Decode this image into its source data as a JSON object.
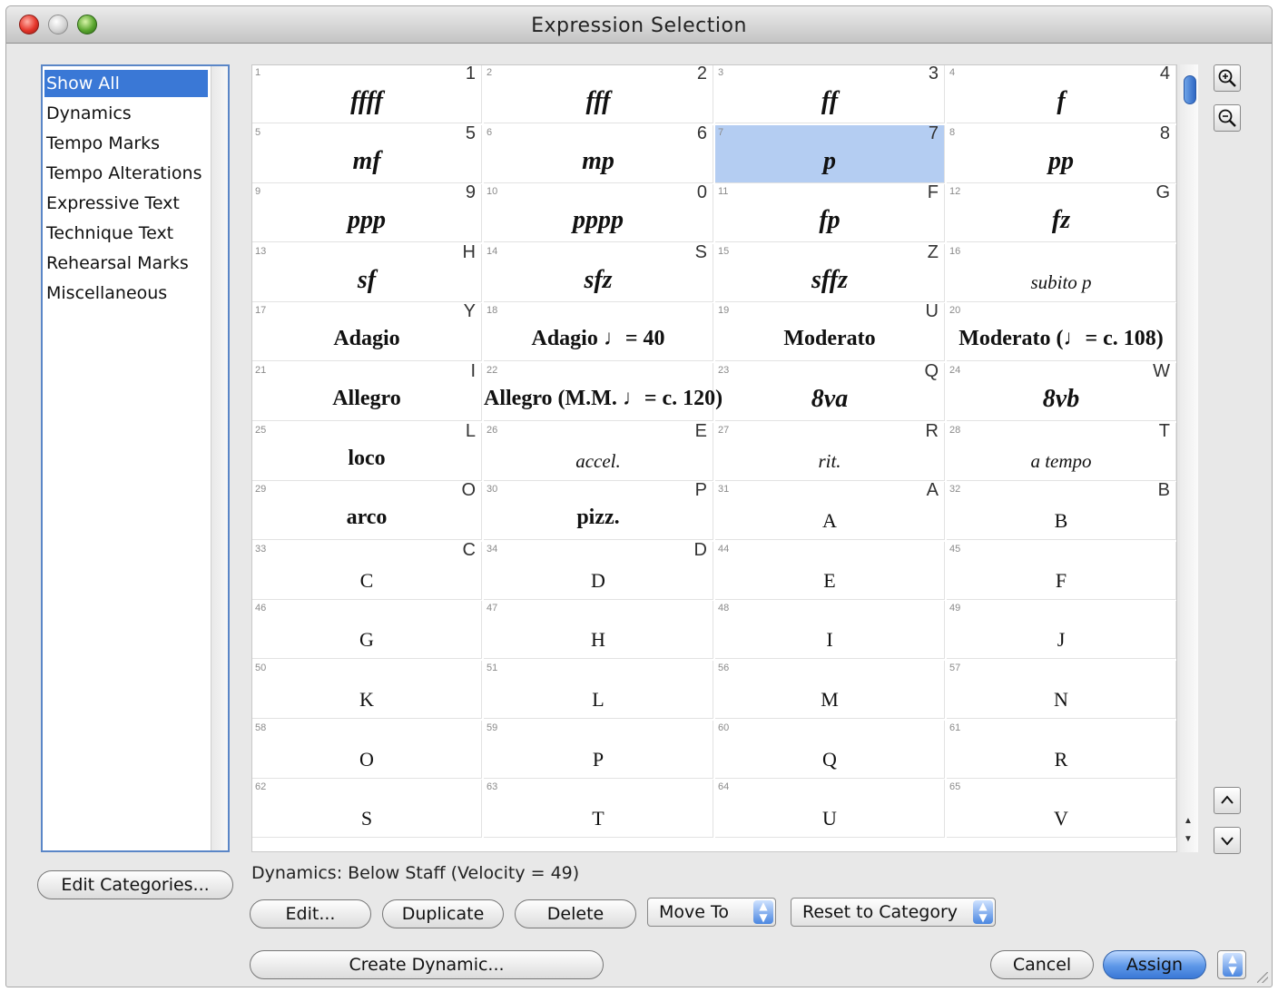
{
  "window": {
    "title": "Expression Selection"
  },
  "categories": [
    "Show All",
    "Dynamics",
    "Tempo Marks",
    "Tempo Alterations",
    "Expressive Text",
    "Technique Text",
    "Rehearsal Marks",
    "Miscellaneous"
  ],
  "selected_category": 0,
  "expressions": [
    {
      "num": "1",
      "key": "1",
      "label": "ffff",
      "style": "bi"
    },
    {
      "num": "2",
      "key": "2",
      "label": "fff",
      "style": "bi"
    },
    {
      "num": "3",
      "key": "3",
      "label": "ff",
      "style": "bi"
    },
    {
      "num": "4",
      "key": "4",
      "label": "f",
      "style": "bi"
    },
    {
      "num": "5",
      "key": "5",
      "label": "mf",
      "style": "bi"
    },
    {
      "num": "6",
      "key": "6",
      "label": "mp",
      "style": "bi"
    },
    {
      "num": "7",
      "key": "7",
      "label": "p",
      "style": "bi",
      "selected": true
    },
    {
      "num": "8",
      "key": "8",
      "label": "pp",
      "style": "bi"
    },
    {
      "num": "9",
      "key": "9",
      "label": "ppp",
      "style": "bi"
    },
    {
      "num": "10",
      "key": "0",
      "label": "pppp",
      "style": "bi"
    },
    {
      "num": "11",
      "key": "F",
      "label": "fp",
      "style": "bi"
    },
    {
      "num": "12",
      "key": "G",
      "label": "fz",
      "style": "bi"
    },
    {
      "num": "13",
      "key": "H",
      "label": "sf",
      "style": "bi"
    },
    {
      "num": "14",
      "key": "S",
      "label": "sfz",
      "style": "bi"
    },
    {
      "num": "15",
      "key": "Z",
      "label": "sffz",
      "style": "bi"
    },
    {
      "num": "16",
      "key": "",
      "label": "subito p",
      "style": "i"
    },
    {
      "num": "17",
      "key": "Y",
      "label": "Adagio",
      "style": "b"
    },
    {
      "num": "18",
      "key": "",
      "label": "Adagio ♩= 40",
      "style": "b"
    },
    {
      "num": "19",
      "key": "U",
      "label": "Moderato",
      "style": "b"
    },
    {
      "num": "20",
      "key": "",
      "label": "Moderato (♩= c. 108)",
      "style": "b"
    },
    {
      "num": "21",
      "key": "I",
      "label": "Allegro",
      "style": "b"
    },
    {
      "num": "22",
      "key": "",
      "label": "Allegro (M.M. ♩= c. 120)",
      "style": "b"
    },
    {
      "num": "23",
      "key": "Q",
      "label": "8va",
      "style": "bi"
    },
    {
      "num": "24",
      "key": "W",
      "label": "8vb",
      "style": "bi"
    },
    {
      "num": "25",
      "key": "L",
      "label": "loco",
      "style": "b"
    },
    {
      "num": "26",
      "key": "E",
      "label": "accel.",
      "style": "i"
    },
    {
      "num": "27",
      "key": "R",
      "label": "rit.",
      "style": "i"
    },
    {
      "num": "28",
      "key": "T",
      "label": "a tempo",
      "style": "i"
    },
    {
      "num": "29",
      "key": "O",
      "label": "arco",
      "style": "b"
    },
    {
      "num": "30",
      "key": "P",
      "label": "pizz.",
      "style": "b"
    },
    {
      "num": "31",
      "key": "A",
      "label": "A",
      "style": ""
    },
    {
      "num": "32",
      "key": "B",
      "label": "B",
      "style": ""
    },
    {
      "num": "33",
      "key": "C",
      "label": "C",
      "style": ""
    },
    {
      "num": "34",
      "key": "D",
      "label": "D",
      "style": ""
    },
    {
      "num": "44",
      "key": "",
      "label": "E",
      "style": ""
    },
    {
      "num": "45",
      "key": "",
      "label": "F",
      "style": ""
    },
    {
      "num": "46",
      "key": "",
      "label": "G",
      "style": ""
    },
    {
      "num": "47",
      "key": "",
      "label": "H",
      "style": ""
    },
    {
      "num": "48",
      "key": "",
      "label": "I",
      "style": ""
    },
    {
      "num": "49",
      "key": "",
      "label": "J",
      "style": ""
    },
    {
      "num": "50",
      "key": "",
      "label": "K",
      "style": ""
    },
    {
      "num": "51",
      "key": "",
      "label": "L",
      "style": ""
    },
    {
      "num": "56",
      "key": "",
      "label": "M",
      "style": ""
    },
    {
      "num": "57",
      "key": "",
      "label": "N",
      "style": ""
    },
    {
      "num": "58",
      "key": "",
      "label": "O",
      "style": ""
    },
    {
      "num": "59",
      "key": "",
      "label": "P",
      "style": ""
    },
    {
      "num": "60",
      "key": "",
      "label": "Q",
      "style": ""
    },
    {
      "num": "61",
      "key": "",
      "label": "R",
      "style": ""
    },
    {
      "num": "62",
      "key": "",
      "label": "S",
      "style": ""
    },
    {
      "num": "63",
      "key": "",
      "label": "T",
      "style": ""
    },
    {
      "num": "64",
      "key": "",
      "label": "U",
      "style": ""
    },
    {
      "num": "65",
      "key": "",
      "label": "V",
      "style": ""
    }
  ],
  "status_text": "Dynamics: Below Staff (Velocity = 49)",
  "buttons": {
    "edit_categories": "Edit Categories...",
    "edit": "Edit...",
    "duplicate": "Duplicate",
    "delete": "Delete",
    "create_dynamic": "Create Dynamic...",
    "cancel": "Cancel",
    "assign": "Assign"
  },
  "popups": {
    "move_to": "Move To",
    "reset_to_category": "Reset to Category"
  },
  "icons": {
    "zoom_in": "zoom-in-icon",
    "zoom_out": "zoom-out-icon",
    "page_up": "chevron-up-icon",
    "page_down": "chevron-down-icon"
  },
  "colors": {
    "accent": "#3a78d6",
    "selection": "#b4cdf2"
  }
}
